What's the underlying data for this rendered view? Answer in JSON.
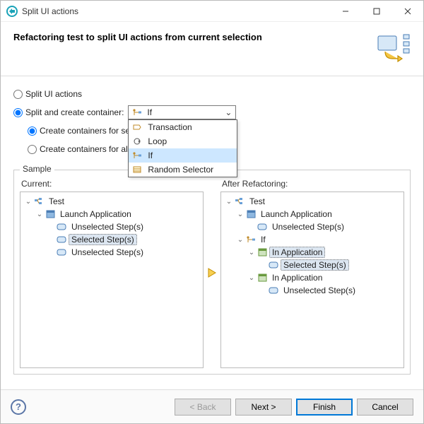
{
  "window": {
    "title": "Split UI actions"
  },
  "header": {
    "heading": "Refactoring test to split UI actions from current selection"
  },
  "options": {
    "splitOnly": {
      "label": "Split UI actions",
      "checked": false
    },
    "splitCreate": {
      "label": "Split and create container:",
      "checked": true
    },
    "combo": {
      "selected": "If",
      "items": [
        "Transaction",
        "Loop",
        "If",
        "Random Selector"
      ]
    },
    "sub": {
      "forSel": {
        "label": "Create containers for sel",
        "checked": true
      },
      "forAll": {
        "label": "Create containers for all",
        "checked": false
      }
    }
  },
  "sample": {
    "legend": "Sample",
    "currentLabel": "Current:",
    "afterLabel": "After Refactoring:",
    "current": {
      "test": "Test",
      "launch": "Launch Application",
      "unselected": "Unselected Step(s)",
      "selected": "Selected Step(s)"
    },
    "after": {
      "test": "Test",
      "launch": "Launch Application",
      "unselected": "Unselected Step(s)",
      "ifNode": "If",
      "inApp": "In Application",
      "selected": "Selected Step(s)"
    }
  },
  "footer": {
    "back": "< Back",
    "next": "Next >",
    "finish": "Finish",
    "cancel": "Cancel"
  },
  "icons": {
    "help": "?"
  }
}
